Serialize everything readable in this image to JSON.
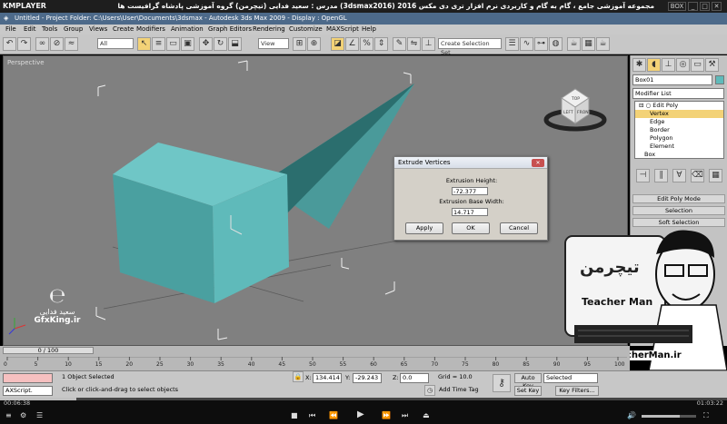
{
  "player": {
    "logo": "KMPLAYER",
    "title": "مجموعه آموزشی جامع ، گام به گام و کاربردی نرم افزار تری دی مکس 2016 (3dsmax2016)  مدرس : سعید فدایی (تیچرمن) گروه آموزشی پادشاه گرافیست ها",
    "current_time": "00:06:38",
    "total_time": "01:03:22",
    "progress_fraction": 0.105,
    "window_buttons": [
      "BOX",
      "_",
      "□",
      "✕"
    ]
  },
  "app": {
    "title": "Untitled    - Project Folder: C:\\Users\\User\\Documents\\3dsmax    - Autodesk 3ds Max  2009       - Display : OpenGL"
  },
  "menu": [
    "File",
    "Edit",
    "Tools",
    "Group",
    "Views",
    "Create",
    "Modifiers",
    "Animation",
    "Graph Editors",
    "Rendering",
    "Customize",
    "MAXScript",
    "Help"
  ],
  "toolbar": {
    "filter_value": "All",
    "view_value": "View",
    "selection_set_placeholder": "Create Selection Set"
  },
  "viewport": {
    "label": "Perspective",
    "viewcube_front": "LEFT",
    "viewcube_right": "FRONT",
    "viewcube_top": "TOP"
  },
  "dialog": {
    "title": "Extrude Vertices",
    "height_label": "Extrusion Height:",
    "height_value": "-72.377",
    "width_label": "Extrusion Base Width:",
    "width_value": "14.717",
    "apply": "Apply",
    "ok": "OK",
    "cancel": "Cancel"
  },
  "command_panel": {
    "object_name": "Box01",
    "modifier_list": "Modifier List",
    "stack": [
      "Edit Poly",
      "Vertex",
      "Edge",
      "Border",
      "Polygon",
      "Element",
      "Box"
    ],
    "buttons": [
      "Edit Poly Mode",
      "Selection",
      "Soft Selection"
    ]
  },
  "timeline": {
    "slider": "0 / 100",
    "ticks": [
      "0",
      "5",
      "10",
      "15",
      "20",
      "25",
      "30",
      "35",
      "40",
      "45",
      "50",
      "55",
      "60",
      "65",
      "70",
      "75",
      "80",
      "85",
      "90",
      "95",
      "100"
    ]
  },
  "status": {
    "maxscript": "AXScript.",
    "selected": "1 Object Selected",
    "prompt": "Click or click-and-drag to select objects",
    "x_label": "X:",
    "x": "134.414",
    "y_label": "Y:",
    "y": "-29.243",
    "z_label": "Z:",
    "z": "0.0",
    "grid": "Grid = 10.0",
    "add_time_tag": "Add Time Tag",
    "auto_key": "Auto Key",
    "selected_dropdown": "Selected",
    "set_key": "Set Key",
    "key_filters": "Key Filters..."
  },
  "watermark": {
    "brand": "GfxKing.ir",
    "author": "سعید فدایی",
    "logo_fa": "تیچرمن",
    "logo_en": "Teacher Man",
    "url": "www.TeacherMan.ir"
  }
}
